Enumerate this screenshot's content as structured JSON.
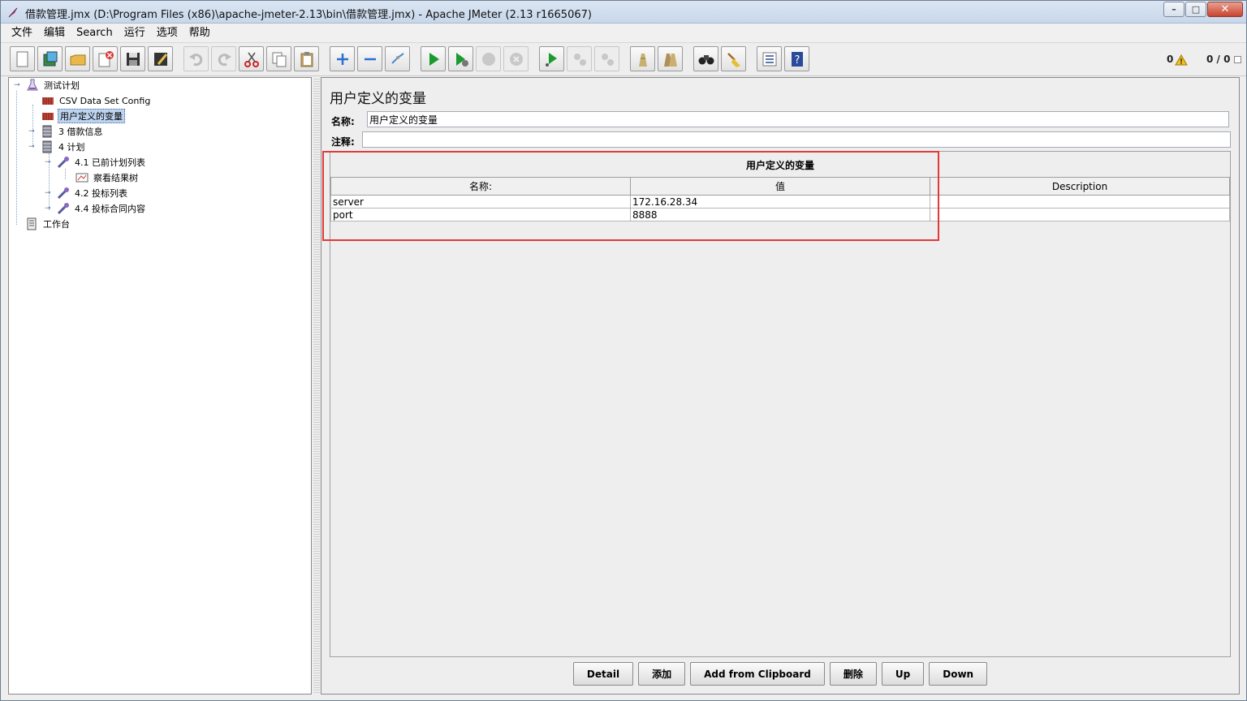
{
  "window": {
    "title": "借款管理.jmx (D:\\Program Files (x86)\\apache-jmeter-2.13\\bin\\借款管理.jmx) - Apache JMeter (2.13 r1665067)",
    "controls": {
      "minimize": "–",
      "maximize": "□",
      "close": "✕"
    }
  },
  "menu": [
    "文件",
    "编辑",
    "Search",
    "运行",
    "选项",
    "帮助"
  ],
  "toolbar": {
    "icons": [
      "new-icon",
      "templates-icon",
      "open-icon",
      "close-file-icon",
      "save-icon",
      "save-as-icon",
      "undo-icon",
      "redo-icon",
      "cut-icon",
      "copy-icon",
      "paste-icon",
      "expand-icon",
      "collapse-icon",
      "toggle-icon",
      "start-icon",
      "start-no-timers-icon",
      "stop-icon",
      "shutdown-icon",
      "remote-start-icon",
      "remote-stop-icon",
      "remote-exit-icon",
      "clear-icon",
      "clear-all-icon",
      "search-icon",
      "reset-search-icon",
      "function-helper-icon",
      "help-icon"
    ],
    "error_count": "0",
    "threads": "0 / 0"
  },
  "tree": {
    "nodes": [
      {
        "label": "测试计划"
      },
      {
        "label": "CSV Data Set Config"
      },
      {
        "label": "用户定义的变量"
      },
      {
        "label": "3 借款信息"
      },
      {
        "label": "4 计划"
      },
      {
        "label": "4.1 已前计划列表"
      },
      {
        "label": "察看结果树"
      },
      {
        "label": "4.2 投标列表"
      },
      {
        "label": "4.4 投标合同内容"
      },
      {
        "label": "工作台"
      }
    ]
  },
  "panel": {
    "title": "用户定义的变量",
    "name_label": "名称:",
    "name_value": "用户定义的变量",
    "comment_label": "注释:",
    "comment_value": "",
    "group_title": "用户定义的变量",
    "columns": [
      "名称:",
      "值",
      "Description"
    ],
    "rows": [
      {
        "name": "server",
        "value": "172.16.28.34",
        "description": ""
      },
      {
        "name": "port",
        "value": "8888",
        "description": ""
      }
    ],
    "buttons": [
      "Detail",
      "添加",
      "Add from Clipboard",
      "删除",
      "Up",
      "Down"
    ]
  }
}
